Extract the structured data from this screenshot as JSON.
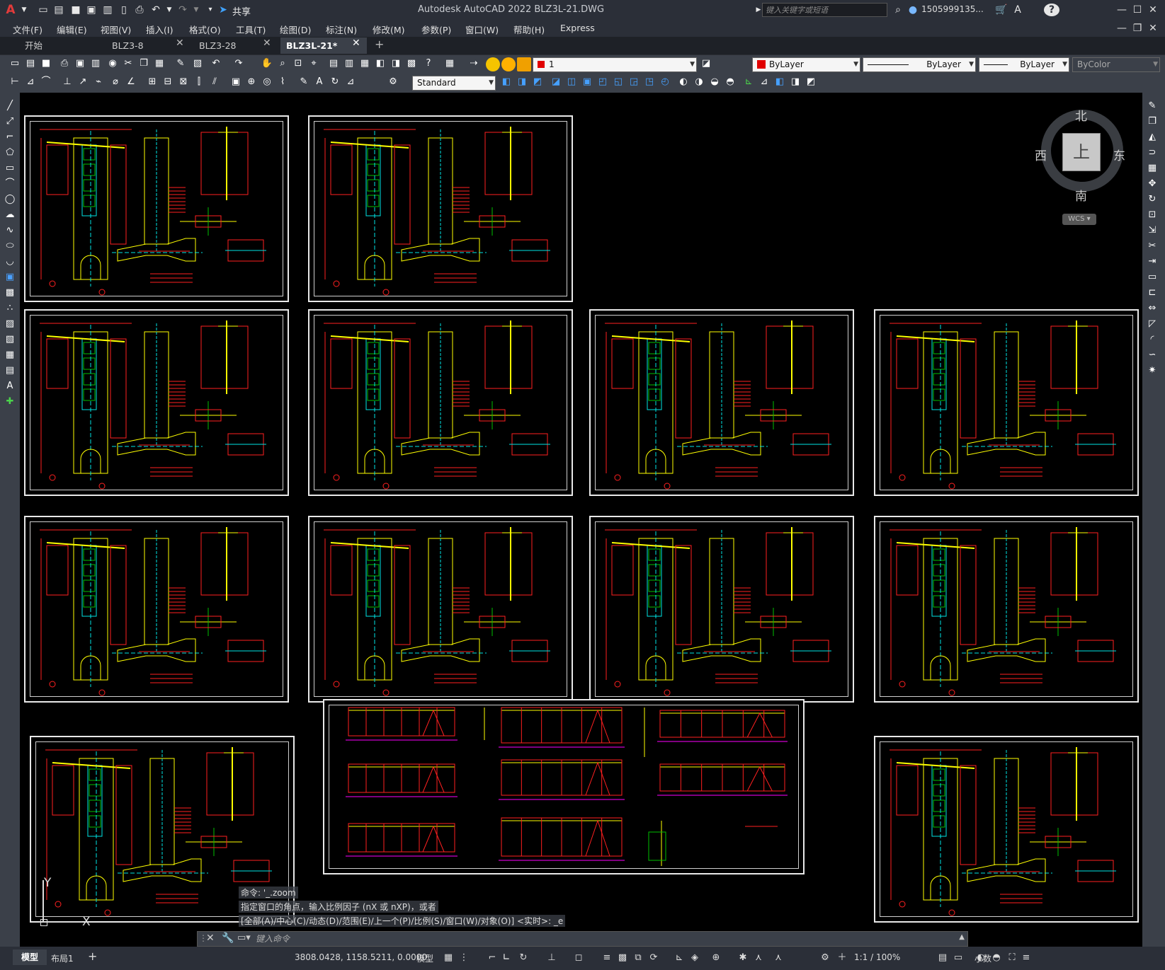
{
  "titlebar": {
    "app_icon": "A",
    "title": "Autodesk AutoCAD 2022    BLZ3L-21.DWG",
    "share_label": "共享",
    "search_placeholder": "键入关键字或短语",
    "user": "1505999135...",
    "help_icon": "?"
  },
  "menu": [
    "文件(F)",
    "编辑(E)",
    "视图(V)",
    "插入(I)",
    "格式(O)",
    "工具(T)",
    "绘图(D)",
    "标注(N)",
    "修改(M)",
    "参数(P)",
    "窗口(W)",
    "帮助(H)",
    "Express"
  ],
  "tabs": [
    {
      "label": "开始",
      "active": false
    },
    {
      "label": "BLZ3-8",
      "active": false
    },
    {
      "label": "BLZ3-28",
      "active": false
    },
    {
      "label": "BLZ3L-21*",
      "active": true
    }
  ],
  "toolbar": {
    "layer_value": "1",
    "color_value": "ByLayer",
    "linetype_value": "ByLayer",
    "lineweight_value": "ByLayer",
    "plotstyle_value": "ByColor",
    "textstyle_value": "Standard"
  },
  "viewcube": {
    "north": "北",
    "south": "南",
    "east": "东",
    "west": "西",
    "top": "上",
    "wcs": "WCS"
  },
  "ucs": {
    "y": "Y",
    "x": "X"
  },
  "command": {
    "history": [
      "命令: '_.zoom",
      "指定窗口的角点，输入比例因子 (nX 或 nXP)，或者",
      "[全部(A)/中心(C)/动态(D)/范围(E)/上一个(P)/比例(S)/窗口(W)/对象(O)] <实时>: _e"
    ],
    "placeholder": "键入命令"
  },
  "status": {
    "model_tab": "模型",
    "layout_tab": "布局1",
    "coords": "3808.0428, 1158.5211, 0.0000",
    "space": "模型",
    "scale": "1:1 / 100%",
    "units": "小数"
  },
  "colors": {
    "accent": "#0078d4",
    "dim_red": "#ff2020",
    "steel_yellow": "#ffff00",
    "bolt_cyan": "#00e5e5",
    "grid_green": "#00c000",
    "axis_magenta": "#ff00ff"
  }
}
